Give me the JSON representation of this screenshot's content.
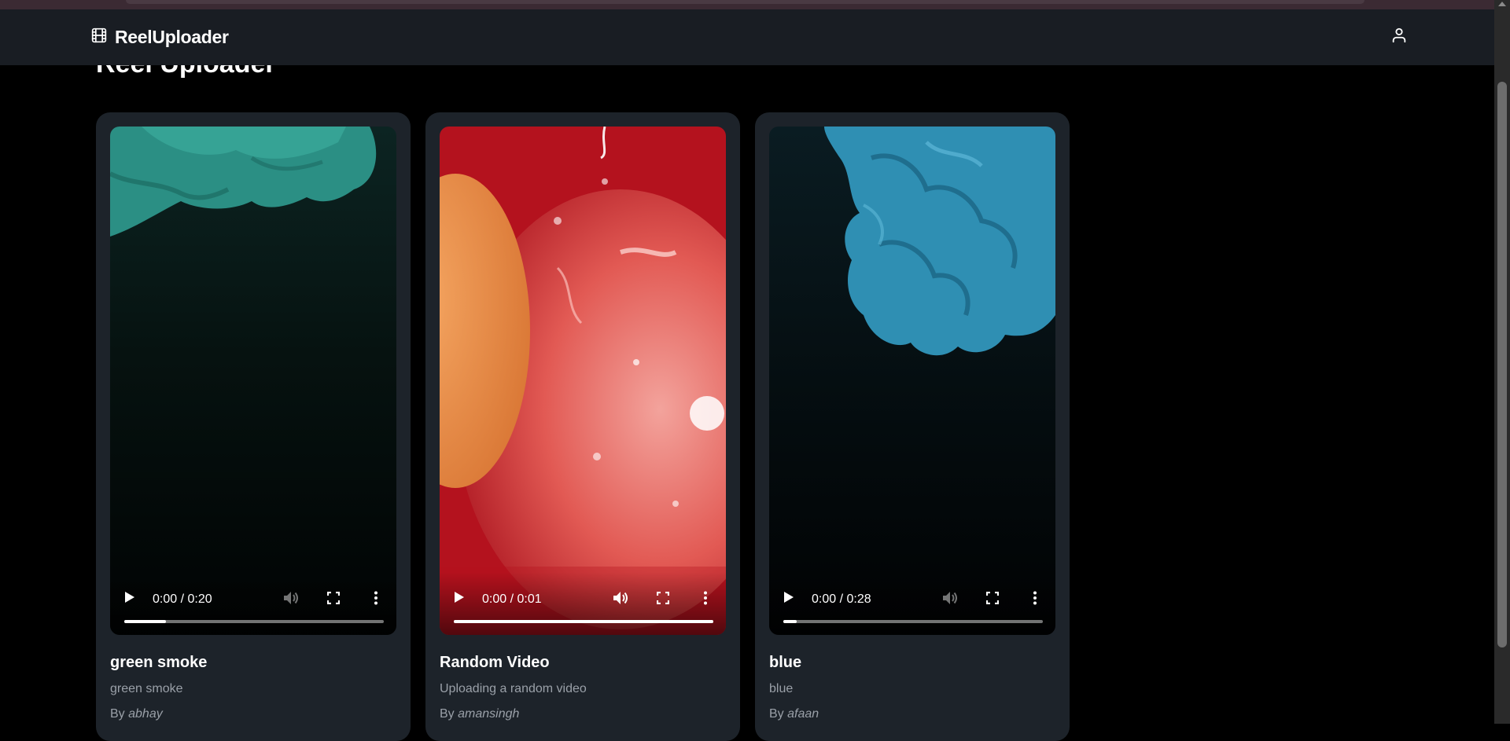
{
  "app": {
    "name": "ReelUploader"
  },
  "page": {
    "title": "Reel Uploader"
  },
  "videos": [
    {
      "title": "green smoke",
      "description": "green smoke",
      "by_prefix": "By",
      "author": "abhay",
      "time": "0:00 / 0:20",
      "progress": 0.16,
      "muted_dim": true
    },
    {
      "title": "Random Video",
      "description": "Uploading a random video",
      "by_prefix": "By",
      "author": "amansingh",
      "time": "0:00 / 0:01",
      "progress": 1.0,
      "muted_dim": false
    },
    {
      "title": "blue",
      "description": "blue",
      "by_prefix": "By",
      "author": "afaan",
      "time": "0:00 / 0:28",
      "progress": 0.05,
      "muted_dim": true
    }
  ],
  "colors": {
    "page_bg": "#000000",
    "navbar_bg": "#191d23",
    "card_bg": "#1d232a",
    "muted_text": "#9aa0a8"
  },
  "icons": {
    "brand": "film-icon",
    "user": "user-icon",
    "play": "play-icon",
    "volume": "volume-icon",
    "fullscreen": "fullscreen-icon",
    "more": "more-vertical-icon"
  }
}
